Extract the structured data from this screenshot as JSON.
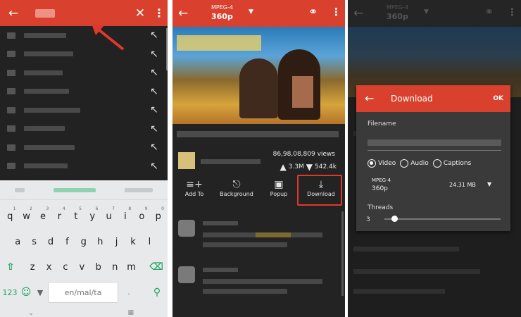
{
  "panel1": {
    "kb_middle_key": "en/mal/ta",
    "kb_num_key": "123",
    "rows": [
      [
        "q",
        "w",
        "e",
        "r",
        "t",
        "y",
        "u",
        "i",
        "o",
        "p"
      ],
      [
        "a",
        "s",
        "d",
        "f",
        "g",
        "h",
        "j",
        "k",
        "l"
      ],
      [
        "z",
        "x",
        "c",
        "v",
        "b",
        "n",
        "m"
      ]
    ],
    "hints": [
      "1",
      "2",
      "3",
      "4",
      "5",
      "6",
      "7",
      "8",
      "9",
      "0"
    ]
  },
  "panel2": {
    "format": "MPEG-4",
    "quality": "360p",
    "views": "86,98,08,809 views",
    "likes": "3.3M",
    "dislikes": "542.4k",
    "actions": {
      "add_to": "Add To",
      "background": "Background",
      "popup": "Popup",
      "download": "Download"
    }
  },
  "panel3": {
    "format": "MPEG-4",
    "quality": "360p",
    "dialog": {
      "title": "Download",
      "ok": "OK",
      "filename_label": "Filename",
      "radio_video": "Video",
      "radio_audio": "Audio",
      "radio_captions": "Captions",
      "stream_format": "MPEG-4",
      "stream_quality": "360p",
      "stream_size": "24.31 MB",
      "threads_label": "Threads",
      "threads_value": "3"
    }
  },
  "colors": {
    "accent": "#d9412e",
    "annotation": "#e0382a"
  }
}
